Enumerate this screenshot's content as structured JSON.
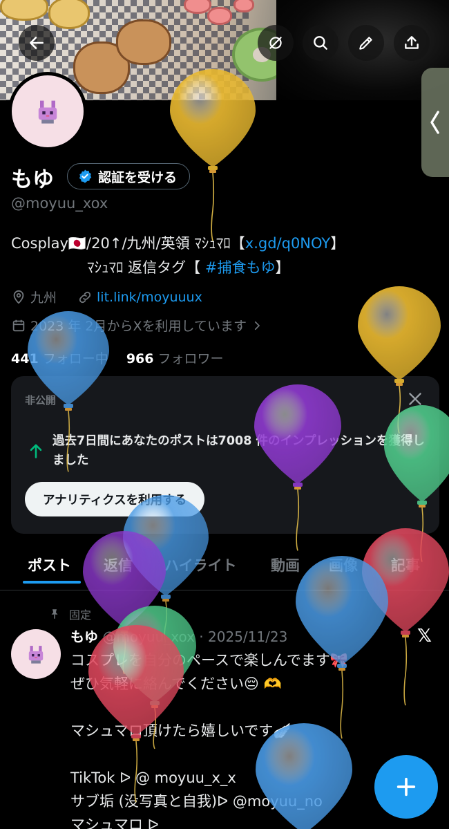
{
  "header": {
    "back_icon": "arrow-left-icon",
    "actions": [
      "grok-icon",
      "search-icon",
      "edit-pen-icon",
      "share-icon"
    ]
  },
  "profile": {
    "name": "もゆ",
    "verify_label": "認証を受ける",
    "handle": "@moyuu_xox",
    "bio_line1_prefix": "Cosplay🇯🇵/20↑/九州/英領 ﾏｼｭﾏﾛ【",
    "bio_link1": "x.gd/q0NOY",
    "bio_line1_suffix": "】",
    "bio_line2_prefix": "ﾏｼｭﾏﾛ 返信タグ【 ",
    "bio_hashtag": "#捕食もゆ",
    "bio_line2_suffix": "】",
    "location": "九州",
    "website": "lit.link/moyuuux",
    "joined": "2023 年 2月からXを利用しています",
    "following_count": "441",
    "following_label": "フォロー中",
    "followers_count": "966",
    "followers_label": "フォロワー"
  },
  "analytics_card": {
    "tag": "非公開",
    "message": "過去7日間にあなたのポストは7008 件のインプレッションを獲得しました",
    "button": "アナリティクスを利用する"
  },
  "tabs": [
    "ポスト",
    "返信",
    "ハイライト",
    "動画",
    "画像",
    "記事"
  ],
  "active_tab": "ポスト",
  "pinned_post": {
    "pinned_label": "固定",
    "author": "もゆ",
    "handle_date": "@moyuu_xox · 2025/11/23",
    "text": "コスプレを自分のペースで楽しんでます🎀\nぜひ気軽に絡んでください😔 🫶\n\nマシュマロ頂けたら嬉しいです🪽\n\nTikTok ᐅ @ moyuu_x_x\nサブ垢 (没写真と自我)ᐅ @moyuu_no\nマシュマロ ᐅ"
  },
  "colors": {
    "accent": "#1d9bf0",
    "balloon_blue": "#4a9be6",
    "balloon_yellow": "#e8b830",
    "balloon_purple": "#8f3ad0",
    "balloon_green": "#4fc98a",
    "balloon_red": "#e0485e"
  }
}
